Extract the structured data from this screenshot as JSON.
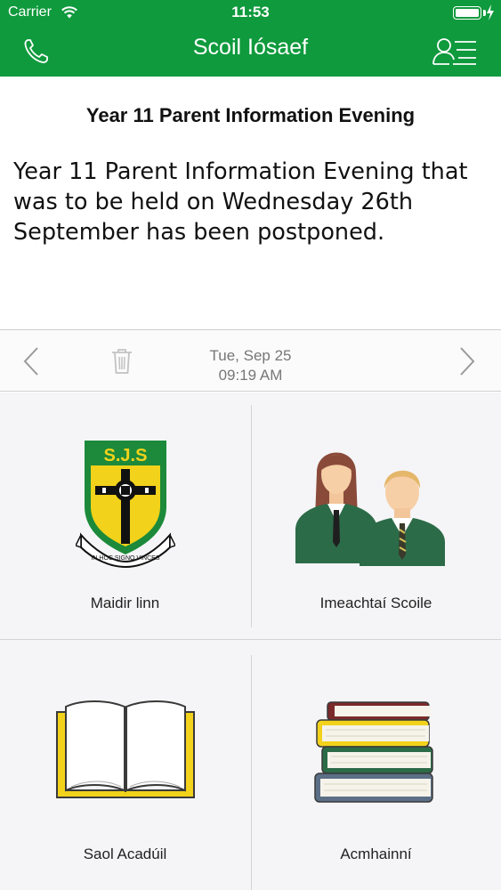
{
  "status_bar": {
    "carrier": "Carrier",
    "time": "11:53"
  },
  "nav": {
    "title": "Scoil Iósaef",
    "left_icon": "phone-icon",
    "right_icon": "profile-list-icon"
  },
  "message": {
    "title": "Year 11 Parent Information Evening",
    "body": "Year 11 Parent Information Evening that was to be held on Wednesday 26th September has been postponed.",
    "date": "Tue, Sep 25",
    "time": "09:19 AM"
  },
  "tiles": [
    {
      "label": "Maidir linn",
      "icon": "school-crest-icon",
      "crest_text": "S.J.S",
      "motto": "IN HOC SIGNO VINCES"
    },
    {
      "label": "Imeachtaí Scoile",
      "icon": "students-icon"
    },
    {
      "label": "Saol Acadúil",
      "icon": "open-book-icon"
    },
    {
      "label": "Acmhainní",
      "icon": "book-stack-icon"
    }
  ],
  "colors": {
    "brand_green": "#0f9a3d",
    "crest_yellow": "#f2d21b",
    "crest_green": "#1c8a3a"
  }
}
